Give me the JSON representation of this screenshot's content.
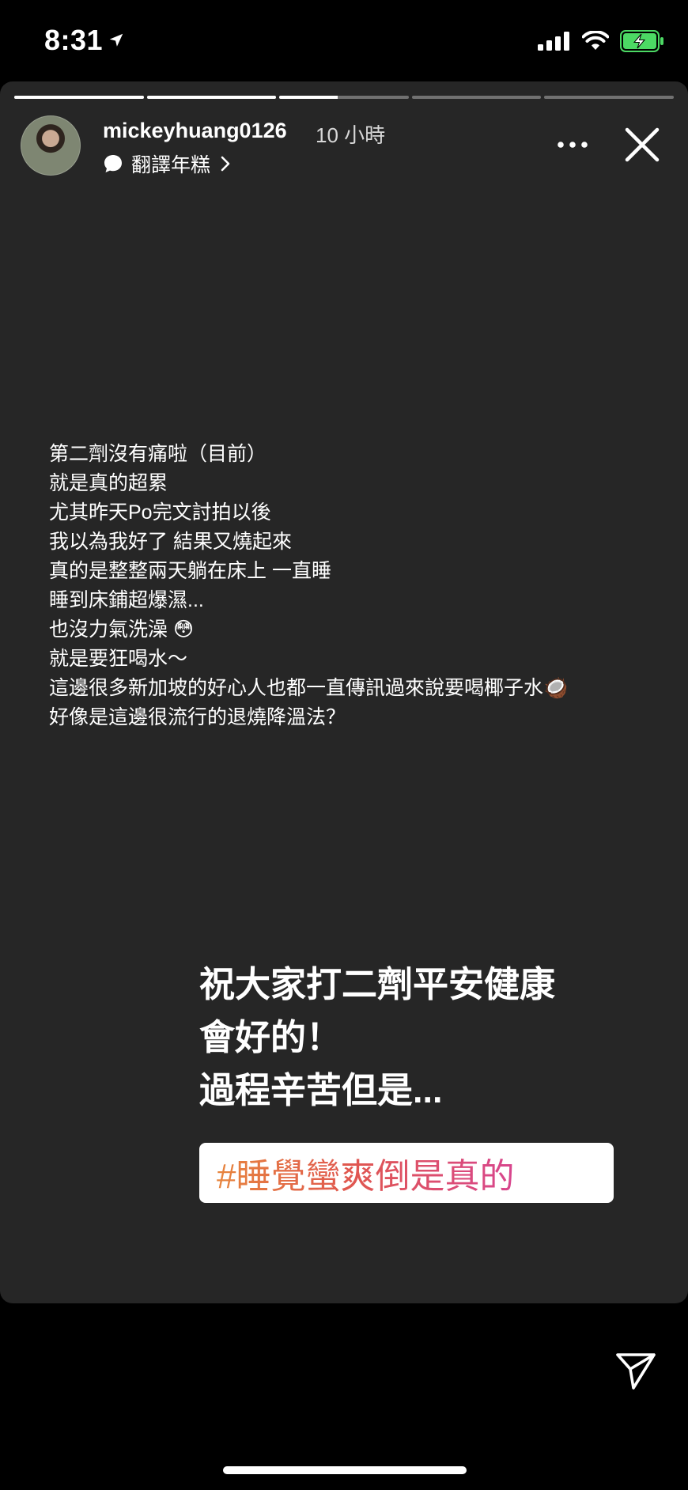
{
  "status_bar": {
    "time": "8:31",
    "icons": [
      "location-arrow-icon",
      "cellular-signal-icon",
      "wifi-icon",
      "battery-charging-icon"
    ],
    "battery_color": "#4cd964"
  },
  "story": {
    "progress_segments": [
      1.0,
      1.0,
      0.45,
      0.0,
      0.0
    ],
    "username": "mickeyhuang0126",
    "timeago": "10 小時",
    "translate_label": "翻譯年糕",
    "icons": [
      "more-options-icon",
      "close-icon",
      "chat-bubble-icon",
      "chevron-right-icon"
    ],
    "body_lines": [
      "第二劑沒有痛啦（目前）",
      "就是真的超累",
      "尤其昨天Po完文討拍以後",
      "我以為我好了 結果又燒起來",
      "真的是整整兩天躺在床上 一直睡",
      "睡到床鋪超爆濕...",
      "也沒力氣洗澡 😳",
      "就是要狂喝水～",
      "這邊很多新加坡的好心人也都一直傳訊過來說要喝椰子水🥥",
      "好像是這邊很流行的退燒降溫法？"
    ],
    "big_lines": [
      "祝大家打二劑平安健康",
      "會好的！",
      "過程辛苦但是..."
    ],
    "hashtag": "#睡覺蠻爽倒是真的",
    "hashtag_gradient": [
      "#e7853d",
      "#e0574f",
      "#d8468e"
    ]
  },
  "footer": {
    "icons": [
      "send-direct-icon"
    ]
  }
}
